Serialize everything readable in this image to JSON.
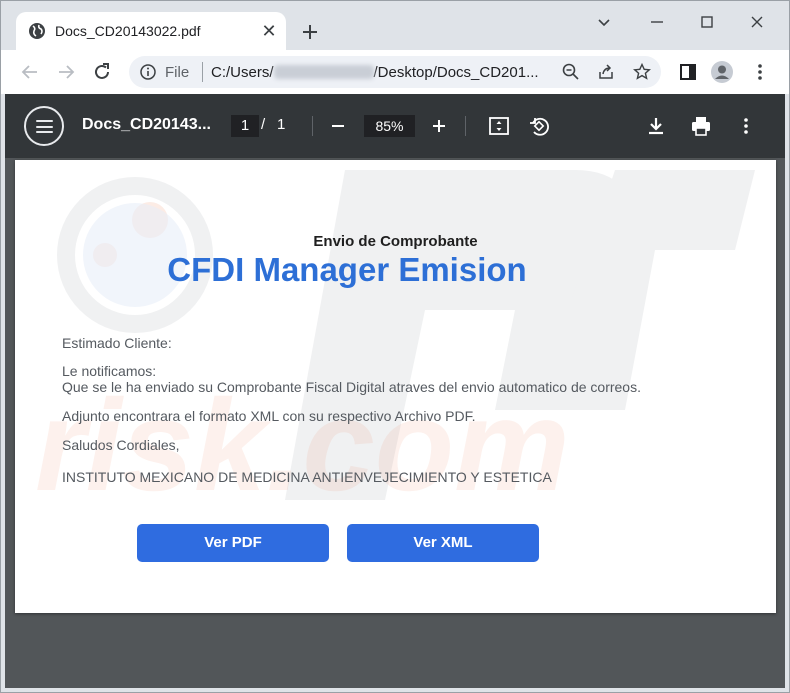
{
  "browser": {
    "tab_title": "Docs_CD20143022.pdf",
    "tab_close": "✕",
    "scheme_label": "File",
    "url_prefix": "C:/Users/",
    "url_suffix": "/Desktop/Docs_CD201..."
  },
  "pdf_toolbar": {
    "doc_title": "Docs_CD20143...",
    "current_page": "1",
    "page_separator": "/",
    "total_pages": "1",
    "zoom": "85%"
  },
  "document": {
    "subtitle": "Envio de Comprobante",
    "brand_title": "CFDI Manager Emision",
    "greeting": "Estimado Cliente:",
    "notice_line1": "Le notificamos:",
    "notice_line2": "Que se le ha enviado su Comprobante Fiscal Digital atraves del envio automatico de correos.",
    "attachment_line": "Adjunto encontrara el formato XML con su respectivo Archivo PDF.",
    "closing": "Saludos Cordiales,",
    "sender": "INSTITUTO MEXICANO DE MEDICINA ANTIENVEJECIMIENTO Y ESTETICA",
    "button_pdf": "Ver PDF",
    "button_xml": "Ver XML"
  },
  "colors": {
    "brand_blue": "#2d6fd6",
    "button_blue": "#2f6ce0",
    "pdf_toolbar": "#323639",
    "viewer_bg": "#525659"
  },
  "icons": [
    "globe-icon",
    "close-icon",
    "plus-icon",
    "minimize-icon",
    "maximize-icon",
    "window-close-icon",
    "back-icon",
    "forward-icon",
    "reload-icon",
    "info-icon",
    "zoom-icon",
    "share-icon",
    "star-icon",
    "side-panel-icon",
    "profile-icon",
    "kebab-menu-icon",
    "hamburger-icon",
    "zoom-out-icon",
    "zoom-in-icon",
    "fit-page-icon",
    "rotate-icon",
    "download-icon",
    "print-icon",
    "more-icon"
  ]
}
